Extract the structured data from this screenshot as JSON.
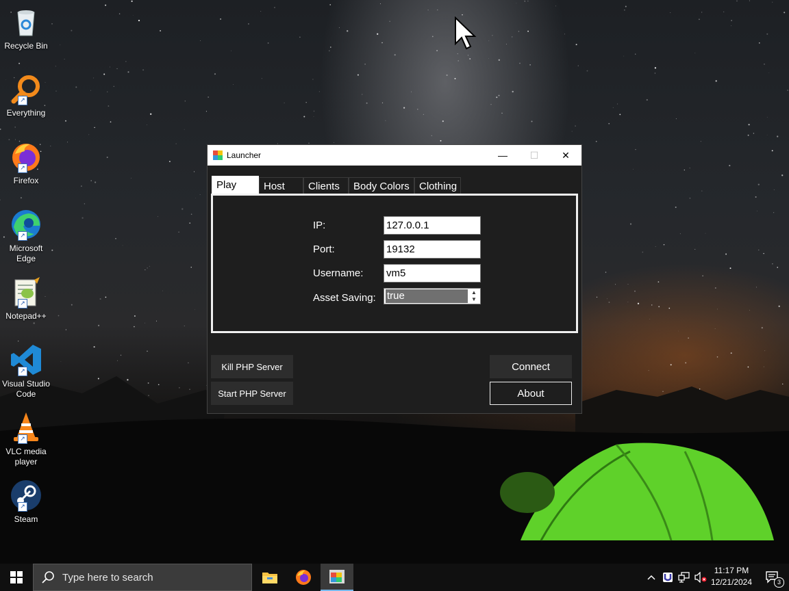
{
  "desktop": {
    "icons": [
      {
        "label": "Recycle Bin",
        "icon": "recycle-bin-icon"
      },
      {
        "label": "Everything",
        "icon": "everything-search-icon"
      },
      {
        "label": "Firefox",
        "icon": "firefox-icon"
      },
      {
        "label": "Microsoft Edge",
        "icon": "edge-icon"
      },
      {
        "label": "Notepad++",
        "icon": "notepad-plus-plus-icon"
      },
      {
        "label": "Visual Studio Code",
        "icon": "vscode-icon"
      },
      {
        "label": "VLC media player",
        "icon": "vlc-icon"
      },
      {
        "label": "Steam",
        "icon": "steam-icon"
      }
    ]
  },
  "window": {
    "title": "Launcher",
    "controls": {
      "minimize": "—",
      "maximize": "☐",
      "close": "✕"
    },
    "tabs": [
      "Play",
      "Host",
      "Clients",
      "Body Colors",
      "Clothing"
    ],
    "active_tab": "Play",
    "play": {
      "ip_label": "IP:",
      "ip_value": "127.0.0.1",
      "port_label": "Port:",
      "port_value": "19132",
      "username_label": "Username:",
      "username_value": "vm5",
      "asset_label": "Asset Saving:",
      "asset_value": "true"
    },
    "buttons": {
      "kill_php": "Kill PHP Server",
      "start_php": "Start PHP Server",
      "connect": "Connect",
      "about": "About"
    }
  },
  "taskbar": {
    "search_placeholder": "Type here to search",
    "time": "11:17 PM",
    "date": "12/21/2024",
    "notification_count": "3",
    "apps": [
      "file-explorer-icon",
      "firefox-icon",
      "launcher-icon"
    ]
  },
  "colors": {
    "window_bg": "#1e1e1e",
    "taskbar_bg": "#101010",
    "accent": "#76b9ed"
  }
}
